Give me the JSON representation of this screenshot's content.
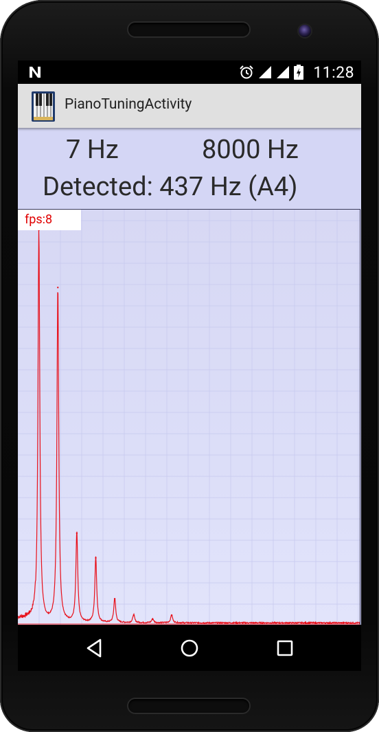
{
  "status_bar": {
    "notification_icon": "n-icon",
    "alarm_icon": "alarm-clock-icon",
    "signal_icon": "signal-icon",
    "wifi_icon": "cell-signal-icon",
    "battery_icon": "battery-charging-icon",
    "time": "11:28"
  },
  "action_bar": {
    "app_icon": "piano-app-icon",
    "title": "PianoTuningActivity"
  },
  "frequency": {
    "min_label": "7 Hz",
    "max_label": "8000 Hz",
    "detected_label": "Detected: 437 Hz (A4)"
  },
  "plot": {
    "fps_label": "fps:8",
    "line_color": "#e8101a",
    "grid_color": "#c6c8ee",
    "background_color": "#d8d9f5"
  },
  "chart_data": {
    "type": "line",
    "title": "",
    "xlabel": "",
    "ylabel": "",
    "xlim": [
      7,
      8000
    ],
    "ylim": [
      0,
      1
    ],
    "series": [
      {
        "name": "",
        "peaks": [
          {
            "x": 437,
            "y": 0.96
          },
          {
            "x": 874,
            "y": 0.82
          },
          {
            "x": 1311,
            "y": 0.22
          },
          {
            "x": 1748,
            "y": 0.16
          },
          {
            "x": 2185,
            "y": 0.06
          },
          {
            "x": 2622,
            "y": 0.02
          },
          {
            "x": 3059,
            "y": 0.01
          },
          {
            "x": 3496,
            "y": 0.02
          }
        ]
      }
    ]
  },
  "nav_bar": {
    "back_icon": "back-triangle-icon",
    "home_icon": "home-circle-icon",
    "recents_icon": "recents-square-icon"
  }
}
